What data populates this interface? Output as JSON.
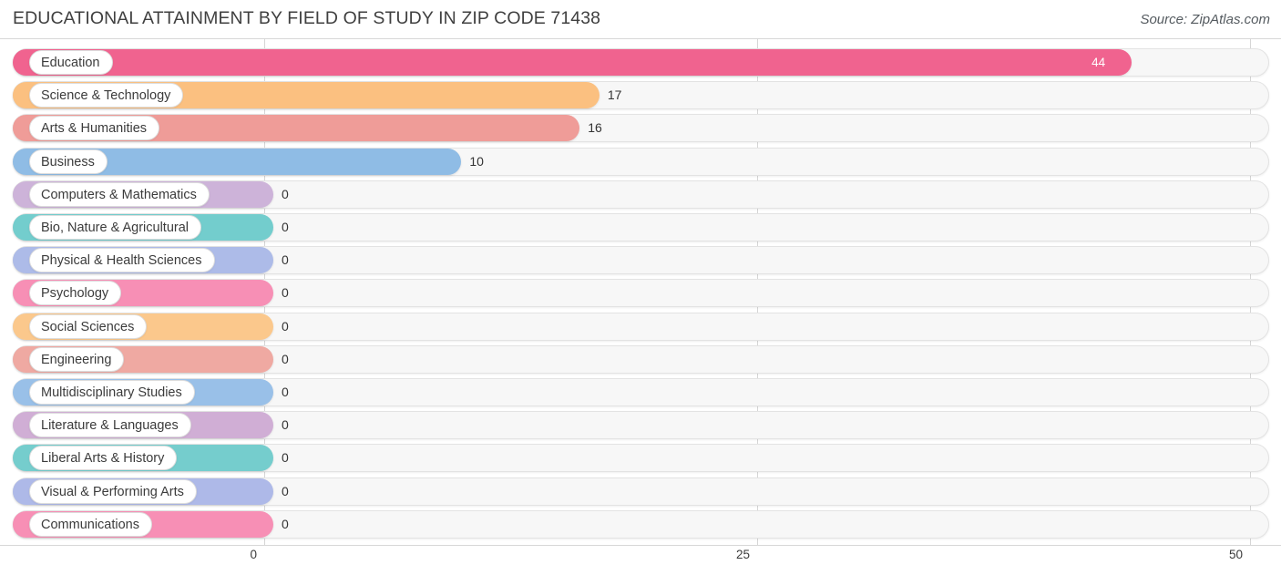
{
  "header": {
    "title": "EDUCATIONAL ATTAINMENT BY FIELD OF STUDY IN ZIP CODE 71438",
    "source": "Source: ZipAtlas.com"
  },
  "chart_data": {
    "type": "bar",
    "orientation": "horizontal",
    "title": "EDUCATIONAL ATTAINMENT BY FIELD OF STUDY IN ZIP CODE 71438",
    "xlabel": "",
    "ylabel": "",
    "xlim": [
      0,
      50
    ],
    "xticks": [
      0,
      25,
      50
    ],
    "xtick_labels": [
      "0",
      "25",
      "50"
    ],
    "grid": true,
    "legend": false,
    "categories": [
      "Education",
      "Science & Technology",
      "Arts & Humanities",
      "Business",
      "Computers & Mathematics",
      "Bio, Nature & Agricultural",
      "Physical & Health Sciences",
      "Psychology",
      "Social Sciences",
      "Engineering",
      "Multidisciplinary Studies",
      "Literature & Languages",
      "Liberal Arts & History",
      "Visual & Performing Arts",
      "Communications"
    ],
    "values": [
      44,
      17,
      16,
      10,
      0,
      0,
      0,
      0,
      0,
      0,
      0,
      0,
      0,
      0,
      0
    ],
    "value_labels": [
      "44",
      "17",
      "16",
      "10",
      "0",
      "0",
      "0",
      "0",
      "0",
      "0",
      "0",
      "0",
      "0",
      "0",
      "0"
    ],
    "colors": [
      "#f0638f",
      "#fbc080",
      "#ef9c98",
      "#8fbce5",
      "#cdb3d9",
      "#73cdcd",
      "#adbbe8",
      "#f78fb5",
      "#fbc88c",
      "#efa9a2",
      "#99c0e8",
      "#d0aed5",
      "#75cdcd",
      "#aeb9e8",
      "#f78fb5"
    ]
  },
  "axis": {
    "ticks": [
      "0",
      "25",
      "50"
    ]
  }
}
